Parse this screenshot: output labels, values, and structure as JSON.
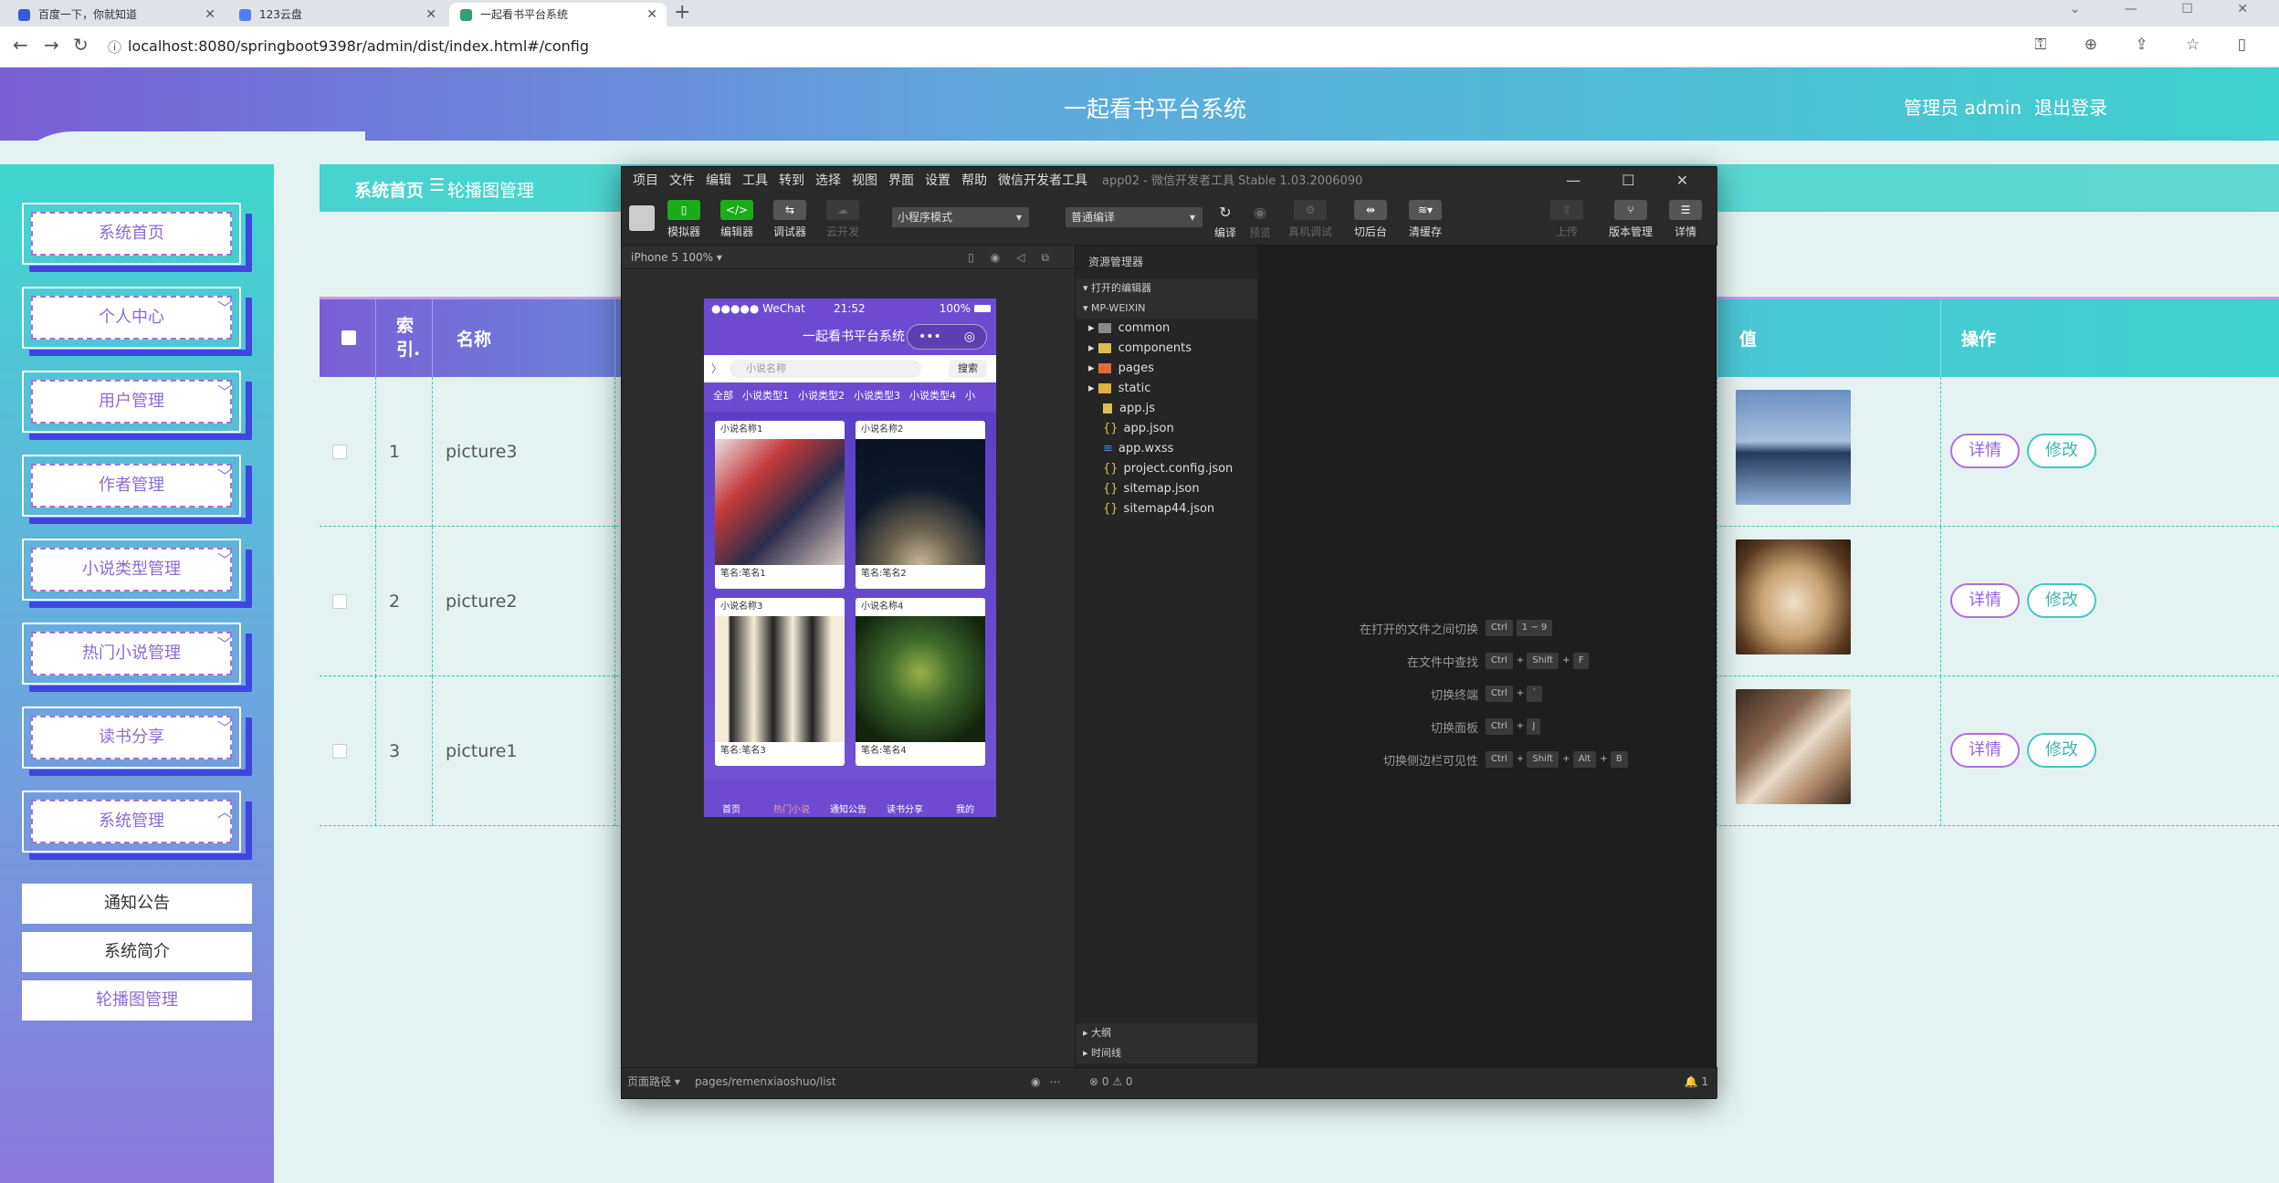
{
  "browser": {
    "tabs": [
      {
        "title": "百度一下，你就知道",
        "color": "#3a5bd9"
      },
      {
        "title": "123云盘",
        "color": "#4f7df3"
      },
      {
        "title": "一起看书平台系统",
        "color": "#2ea26f"
      }
    ],
    "url": "localhost:8080/springboot9398r/admin/dist/index.html#/config"
  },
  "app": {
    "title": "一起看书平台系统",
    "user": "管理员 admin",
    "logout": "退出登录"
  },
  "sidebar": {
    "menus": [
      {
        "label": "系统首页",
        "chevron": ""
      },
      {
        "label": "个人中心",
        "chevron": "﹀"
      },
      {
        "label": "用户管理",
        "chevron": "﹀"
      },
      {
        "label": "作者管理",
        "chevron": "﹀"
      },
      {
        "label": "小说类型管理",
        "chevron": "﹀"
      },
      {
        "label": "热门小说管理",
        "chevron": "﹀"
      },
      {
        "label": "读书分享",
        "chevron": "﹀"
      },
      {
        "label": "系统管理",
        "chevron": "︿"
      }
    ],
    "submenus": [
      "通知公告",
      "系统简介",
      "轮播图管理"
    ]
  },
  "breadcrumb": {
    "home": "系统首页",
    "sep": "☰",
    "current": "轮播图管理"
  },
  "table": {
    "headers": {
      "index": "索\n引.",
      "name": "名称",
      "value": "值",
      "action": "操作"
    },
    "rows": [
      {
        "index": "1",
        "name": "picture3"
      },
      {
        "index": "2",
        "name": "picture2"
      },
      {
        "index": "3",
        "name": "picture1"
      }
    ],
    "detail": "详情",
    "edit": "修改"
  },
  "devtools": {
    "menu": [
      "项目",
      "文件",
      "编辑",
      "工具",
      "转到",
      "选择",
      "视图",
      "界面",
      "设置",
      "帮助",
      "微信开发者工具"
    ],
    "title": "app02 - 微信开发者工具 Stable 1.03.2006090",
    "toolbar": {
      "simulator": "模拟器",
      "editor": "编辑器",
      "debugger": "调试器",
      "cloud": "云开发",
      "mode": "小程序模式",
      "compile_mode": "普通编译",
      "compile": "编译",
      "preview": "预览",
      "remote": "真机调试",
      "backend": "切后台",
      "cache": "清缓存",
      "upload": "上传",
      "version": "版本管理",
      "details": "详情"
    },
    "device": "iPhone 5 100% ▾",
    "phone": {
      "carrier": "●●●●● WeChat",
      "time": "21:52",
      "battery": "100%",
      "nav_title": "一起看书平台系统",
      "search_placeholder": "小说名称",
      "search_btn": "搜索",
      "tabs": [
        "全部",
        "小说类型1",
        "小说类型2",
        "小说类型3",
        "小说类型4",
        "小"
      ],
      "cards": [
        {
          "title": "小说名称1",
          "author": "笔名:笔名1"
        },
        {
          "title": "小说名称2",
          "author": "笔名:笔名2"
        },
        {
          "title": "小说名称3",
          "author": "笔名:笔名3"
        },
        {
          "title": "小说名称4",
          "author": "笔名:笔名4"
        }
      ],
      "tabbar": [
        "首页",
        "热门小说",
        "通知公告",
        "读书分享",
        "我的"
      ]
    },
    "explorer": {
      "title": "资源管理器",
      "open_editors": "打开的编辑器",
      "project": "MP-WEIXIN",
      "folders": [
        "common",
        "components",
        "pages",
        "static"
      ],
      "files": [
        "app.js",
        "app.json",
        "app.wxss",
        "project.config.json",
        "sitemap.json",
        "sitemap44.json"
      ],
      "outline": "大纲",
      "timeline": "时间线"
    },
    "shortcuts": [
      {
        "label": "在打开的文件之间切换",
        "keys": [
          "Ctrl",
          "1 ~ 9"
        ]
      },
      {
        "label": "在文件中查找",
        "keys": [
          "Ctrl",
          "+",
          "Shift",
          "+",
          "F"
        ]
      },
      {
        "label": "切换终端",
        "keys": [
          "Ctrl",
          "+",
          "`"
        ]
      },
      {
        "label": "切换面板",
        "keys": [
          "Ctrl",
          "+",
          "J"
        ]
      },
      {
        "label": "切换侧边栏可见性",
        "keys": [
          "Ctrl",
          "+",
          "Shift",
          "+",
          "Alt",
          "+",
          "B"
        ]
      }
    ],
    "footer": {
      "path_label": "页面路径 ▾",
      "path": "pages/remenxiaoshuo/list",
      "errors": "⊗ 0 ⚠ 0",
      "bell": "🔔 1"
    }
  }
}
